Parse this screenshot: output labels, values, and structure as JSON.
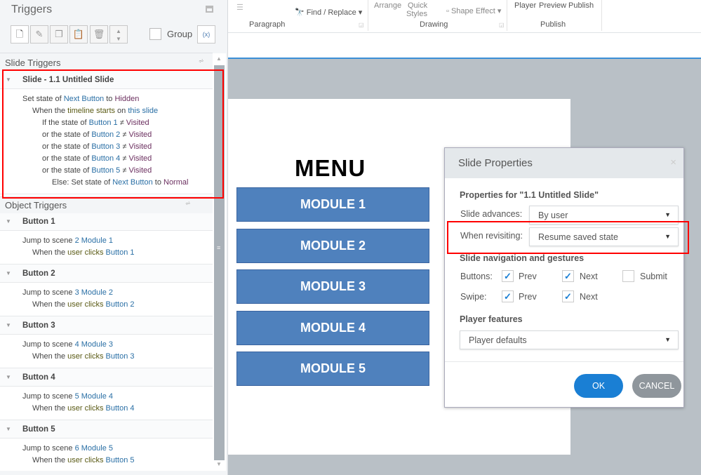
{
  "triggers_panel": {
    "title": "Triggers",
    "group_label": "Group",
    "slide_triggers_label": "Slide Triggers",
    "object_triggers_label": "Object Triggers",
    "slide_group": {
      "title": "Slide - 1.1 Untitled Slide",
      "lines": [
        {
          "indent": 0,
          "segs": [
            [
              "t",
              "Set state of "
            ],
            [
              "o",
              "Next Button"
            ],
            [
              "t",
              " to "
            ],
            [
              "s",
              "Hidden"
            ]
          ]
        },
        {
          "indent": 1,
          "segs": [
            [
              "t",
              "When the "
            ],
            [
              "e",
              "timeline starts"
            ],
            [
              "t",
              " on "
            ],
            [
              "o",
              "this slide"
            ]
          ]
        },
        {
          "indent": 2,
          "segs": [
            [
              "t",
              "If the state of "
            ],
            [
              "o",
              "Button 1"
            ],
            [
              "t",
              " ≠ "
            ],
            [
              "s",
              "Visited"
            ]
          ]
        },
        {
          "indent": 2,
          "segs": [
            [
              "t",
              "or the state of "
            ],
            [
              "o",
              "Button 2"
            ],
            [
              "t",
              " ≠ "
            ],
            [
              "s",
              "Visited"
            ]
          ]
        },
        {
          "indent": 2,
          "segs": [
            [
              "t",
              "or the state of "
            ],
            [
              "o",
              "Button 3"
            ],
            [
              "t",
              " ≠ "
            ],
            [
              "s",
              "Visited"
            ]
          ]
        },
        {
          "indent": 2,
          "segs": [
            [
              "t",
              "or the state of "
            ],
            [
              "o",
              "Button 4"
            ],
            [
              "t",
              " ≠ "
            ],
            [
              "s",
              "Visited"
            ]
          ]
        },
        {
          "indent": 2,
          "segs": [
            [
              "t",
              "or the state of "
            ],
            [
              "o",
              "Button 5"
            ],
            [
              "t",
              " ≠ "
            ],
            [
              "s",
              "Visited"
            ]
          ]
        },
        {
          "indent": 3,
          "segs": [
            [
              "t",
              "Else: Set state of "
            ],
            [
              "o",
              "Next Button"
            ],
            [
              "t",
              " to "
            ],
            [
              "s",
              "Normal"
            ]
          ]
        }
      ]
    },
    "object_groups": [
      {
        "title": "Button 1",
        "lines": [
          {
            "indent": 0,
            "segs": [
              [
                "t",
                "Jump to scene "
              ],
              [
                "o",
                "2 Module 1"
              ]
            ]
          },
          {
            "indent": 1,
            "segs": [
              [
                "t",
                "When the "
              ],
              [
                "e",
                "user clicks"
              ],
              [
                "t",
                " "
              ],
              [
                "o",
                "Button 1"
              ]
            ]
          }
        ]
      },
      {
        "title": "Button 2",
        "lines": [
          {
            "indent": 0,
            "segs": [
              [
                "t",
                "Jump to scene "
              ],
              [
                "o",
                "3 Module 2"
              ]
            ]
          },
          {
            "indent": 1,
            "segs": [
              [
                "t",
                "When the "
              ],
              [
                "e",
                "user clicks"
              ],
              [
                "t",
                " "
              ],
              [
                "o",
                "Button 2"
              ]
            ]
          }
        ]
      },
      {
        "title": "Button 3",
        "lines": [
          {
            "indent": 0,
            "segs": [
              [
                "t",
                "Jump to scene "
              ],
              [
                "o",
                "4 Module 3"
              ]
            ]
          },
          {
            "indent": 1,
            "segs": [
              [
                "t",
                "When the "
              ],
              [
                "e",
                "user clicks"
              ],
              [
                "t",
                " "
              ],
              [
                "o",
                "Button 3"
              ]
            ]
          }
        ]
      },
      {
        "title": "Button 4",
        "lines": [
          {
            "indent": 0,
            "segs": [
              [
                "t",
                "Jump to scene "
              ],
              [
                "o",
                "5 Module 4"
              ]
            ]
          },
          {
            "indent": 1,
            "segs": [
              [
                "t",
                "When the "
              ],
              [
                "e",
                "user clicks"
              ],
              [
                "t",
                " "
              ],
              [
                "o",
                "Button 4"
              ]
            ]
          }
        ]
      },
      {
        "title": "Button 5",
        "lines": [
          {
            "indent": 0,
            "segs": [
              [
                "t",
                "Jump to scene "
              ],
              [
                "o",
                "6 Module 5"
              ]
            ]
          },
          {
            "indent": 1,
            "segs": [
              [
                "t",
                "When the "
              ],
              [
                "e",
                "user clicks"
              ],
              [
                "t",
                " "
              ],
              [
                "o",
                "Button 5"
              ]
            ]
          }
        ]
      }
    ]
  },
  "ribbon": {
    "find_replace": "Find / Replace",
    "paragraph": "Paragraph",
    "arrange": "Arrange",
    "quick": "Quick",
    "styles": "Styles",
    "shape_effect": "Shape Effect",
    "drawing": "Drawing",
    "player": "Player",
    "preview": "Preview",
    "publish_btn": "Publish",
    "publish_group": "Publish"
  },
  "slide": {
    "title": "MENU",
    "modules": [
      "MODULE 1",
      "MODULE 2",
      "MODULE 3",
      "MODULE 4",
      "MODULE 5"
    ]
  },
  "dialog": {
    "title": "Slide Properties",
    "close": "×",
    "props_for": "Properties for \"1.1 Untitled Slide\"",
    "advances_label": "Slide advances:",
    "advances_value": "By user",
    "revisit_label": "When revisiting:",
    "revisit_value": "Resume saved state",
    "nav_heading": "Slide navigation and gestures",
    "buttons_label": "Buttons:",
    "swipe_label": "Swipe:",
    "prev": "Prev",
    "next": "Next",
    "submit": "Submit",
    "checks": {
      "buttons_prev": true,
      "buttons_next": true,
      "buttons_submit": false,
      "swipe_prev": true,
      "swipe_next": true
    },
    "player_heading": "Player features",
    "player_value": "Player defaults",
    "ok": "OK",
    "cancel": "CANCEL"
  },
  "colors": {
    "accent": "#1a7fd4",
    "module": "#4f81bd",
    "highlight": "#ff0000"
  }
}
